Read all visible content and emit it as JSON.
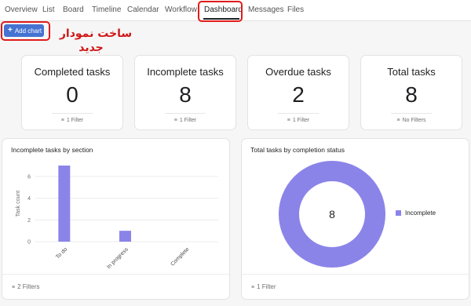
{
  "tabs": [
    "Overview",
    "List",
    "Board",
    "Timeline",
    "Calendar",
    "Workflow",
    "Dashboard",
    "Messages",
    "Files"
  ],
  "active_tab": "Dashboard",
  "add_chart": {
    "label": "Add chart",
    "icon": "plus-icon"
  },
  "annotation": {
    "line1": "ساخت نمودار",
    "line2": "جدید",
    "color": "#d01717"
  },
  "stats": [
    {
      "title": "Completed tasks",
      "value": "0",
      "filter": "1 Filter"
    },
    {
      "title": "Incomplete tasks",
      "value": "8",
      "filter": "1 Filter"
    },
    {
      "title": "Overdue tasks",
      "value": "2",
      "filter": "1 Filter"
    },
    {
      "title": "Total tasks",
      "value": "8",
      "filter": "No Filters"
    }
  ],
  "bar_chart": {
    "title": "Incomplete tasks by section",
    "footer": "2 Filters"
  },
  "donut_chart": {
    "title": "Total tasks by completion status",
    "center_value": "8",
    "footer": "1 Filter"
  },
  "colors": {
    "accent": "#4573d2",
    "bar": "#8b84e8",
    "annotation_box": "#e01b1b"
  },
  "chart_data": [
    {
      "type": "bar",
      "title": "Incomplete tasks by section",
      "categories": [
        "To do",
        "In progress",
        "Complete"
      ],
      "values": [
        7,
        1,
        0
      ],
      "ylabel": "Task count",
      "xlabel": "",
      "ylim": [
        0,
        7
      ],
      "yticks": [
        0,
        2,
        4,
        6
      ],
      "grid": true
    },
    {
      "type": "pie",
      "title": "Total tasks by completion status",
      "labels": [
        "Incomplete"
      ],
      "values": [
        8
      ],
      "center_label": "8",
      "legend": "right",
      "donut": true
    }
  ]
}
